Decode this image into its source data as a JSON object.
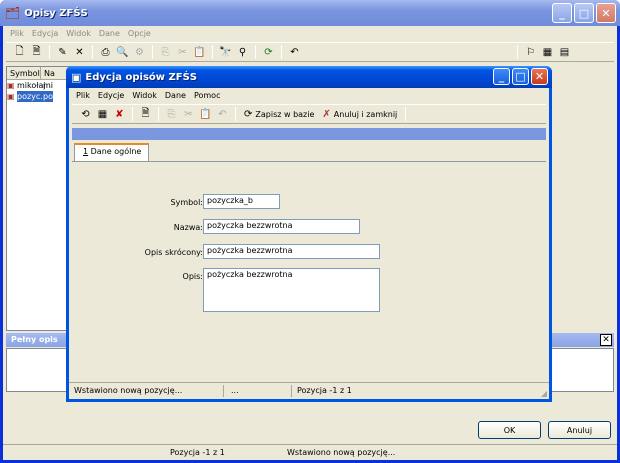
{
  "main": {
    "title": "Opisy ZFŚS",
    "menu": [
      "Plik",
      "Edycja",
      "Widok",
      "Dane",
      "Opcje"
    ],
    "list": {
      "columns": [
        "Symbol",
        "Na"
      ],
      "rows": [
        [
          "mikołaj",
          "mi"
        ],
        [
          "pozyc...",
          "po"
        ]
      ]
    },
    "full_desc_label": "Pełny opis",
    "ok_label": "OK",
    "cancel_label": "Anuluj",
    "status": {
      "position": "Pozycja -1 z 1",
      "message": "Wstawiono nową pozycję..."
    }
  },
  "dialog": {
    "title": "Edycja opisów ZFŚS",
    "menu": [
      "Plik",
      "Edycje",
      "Widok",
      "Dane",
      "Pomoc"
    ],
    "save_label": "Zapisz w bazie",
    "cancel_close_label": "Anuluj i zamknij",
    "tab": {
      "accel": "1",
      "rest": " Dane ogólne"
    },
    "labels": {
      "symbol": "Symbol:",
      "name": "Nazwa:",
      "short": "Opis skrócony:",
      "desc": "Opis:"
    },
    "values": {
      "symbol": "pozyczka_b",
      "name": "pożyczka bezzwrotna",
      "short": "pożyczka bezzwrotna",
      "desc": "pożyczka bezzwrotna"
    },
    "status": {
      "message": "Wstawiono nową pozycję...",
      "ellipsis": "...",
      "position": "Pozycja -1 z 1"
    }
  },
  "colors": {
    "title_blue": "#0054e3",
    "accent": "#7a96df",
    "bg": "#ece9d8"
  }
}
